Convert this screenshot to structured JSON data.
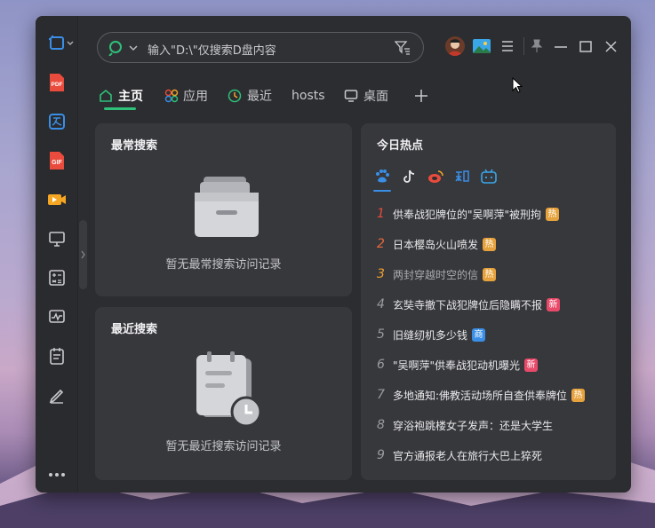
{
  "search": {
    "placeholder": "输入\"D:\\\"仅搜索D盘内容"
  },
  "tabs": [
    {
      "label": "主页",
      "icon": "home-icon"
    },
    {
      "label": "应用",
      "icon": "apps-icon"
    },
    {
      "label": "最近",
      "icon": "clock-icon"
    },
    {
      "label": "hosts",
      "icon": ""
    },
    {
      "label": "桌面",
      "icon": "monitor-icon"
    }
  ],
  "frequent": {
    "title": "最常搜索",
    "empty_text": "暂无最常搜索访问记录"
  },
  "recent": {
    "title": "最近搜索",
    "empty_text": "暂无最近搜索访问记录"
  },
  "hot": {
    "title": "今日热点",
    "sources": [
      "baidu-icon",
      "douyin-icon",
      "weibo-icon",
      "zhihu-icon",
      "bilibili-icon"
    ],
    "items": [
      {
        "rank": "1",
        "title": "供奉战犯牌位的\"吴啊萍\"被刑拘",
        "badge": "热",
        "badge_color": "#e6a23c",
        "rank_color": "#e74c3c"
      },
      {
        "rank": "2",
        "title": "日本樱岛火山喷发",
        "badge": "热",
        "badge_color": "#e6a23c",
        "rank_color": "#e8683c"
      },
      {
        "rank": "3",
        "title": "两封穿越时空的信",
        "badge": "热",
        "badge_color": "#e6a23c",
        "rank_color": "#f0a030"
      },
      {
        "rank": "4",
        "title": "玄奘寺撤下战犯牌位后隐瞒不报",
        "badge": "新",
        "badge_color": "#e84a6a",
        "rank_color": "#9a9ba0"
      },
      {
        "rank": "5",
        "title": "旧缝纫机多少钱",
        "badge": "商",
        "badge_color": "#3a8ee6",
        "rank_color": "#9a9ba0"
      },
      {
        "rank": "6",
        "title": "\"吴啊萍\"供奉战犯动机曝光",
        "badge": "新",
        "badge_color": "#e84a6a",
        "rank_color": "#9a9ba0"
      },
      {
        "rank": "7",
        "title": "多地通知:佛教活动场所自查供奉牌位",
        "badge": "热",
        "badge_color": "#e6a23c",
        "rank_color": "#9a9ba0"
      },
      {
        "rank": "8",
        "title": "穿浴袍跳楼女子发声：还是大学生",
        "badge": "",
        "badge_color": "",
        "rank_color": "#9a9ba0"
      },
      {
        "rank": "9",
        "title": "官方通报老人在旅行大巴上猝死",
        "badge": "",
        "badge_color": "",
        "rank_color": "#9a9ba0"
      }
    ]
  },
  "sidebar": {
    "items": [
      "screenshot-icon",
      "pdf-icon",
      "translate-icon",
      "gif-icon",
      "video-icon",
      "monitor-icon",
      "calculator-icon",
      "activity-icon",
      "notepad-icon",
      "pen-icon",
      "more-icon"
    ],
    "pdf_label": "PDF",
    "gif_label": "GIF"
  },
  "colors": {
    "accent": "#2fc07a",
    "window_bg": "#2c2d30",
    "card_bg": "#37383c"
  }
}
